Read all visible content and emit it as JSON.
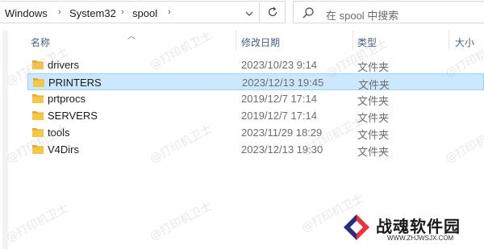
{
  "address_bar": {
    "crumbs": [
      "Windows",
      "System32",
      "spool"
    ],
    "separator": "›",
    "dropdown_icon": "chevron-down-icon",
    "refresh_icon": "refresh-icon"
  },
  "search": {
    "placeholder": "在 spool 中搜索",
    "icon": "search-icon"
  },
  "columns": {
    "name": "名称",
    "date": "修改日期",
    "type": "类型",
    "size": "大小"
  },
  "rows": [
    {
      "name": "drivers",
      "date": "2023/10/23 9:14",
      "type": "文件夹",
      "selected": false
    },
    {
      "name": "PRINTERS",
      "date": "2023/12/13 19:45",
      "type": "文件夹",
      "selected": true
    },
    {
      "name": "prtprocs",
      "date": "2019/12/7 17:14",
      "type": "文件夹",
      "selected": false
    },
    {
      "name": "SERVERS",
      "date": "2019/12/7 17:14",
      "type": "文件夹",
      "selected": false
    },
    {
      "name": "tools",
      "date": "2023/11/29 18:29",
      "type": "文件夹",
      "selected": false
    },
    {
      "name": "V4Dirs",
      "date": "2023/12/13 19:30",
      "type": "文件夹",
      "selected": false
    }
  ],
  "watermark": {
    "text": "@打印机卫士"
  },
  "logo": {
    "title": "战魂软件园",
    "url": "WWW.ZHJWSJX.COM"
  },
  "colors": {
    "selection_bg": "#cce8ff",
    "selection_border": "#99d1ff",
    "folder": "#f6c64b",
    "header_text": "#4c607a"
  }
}
